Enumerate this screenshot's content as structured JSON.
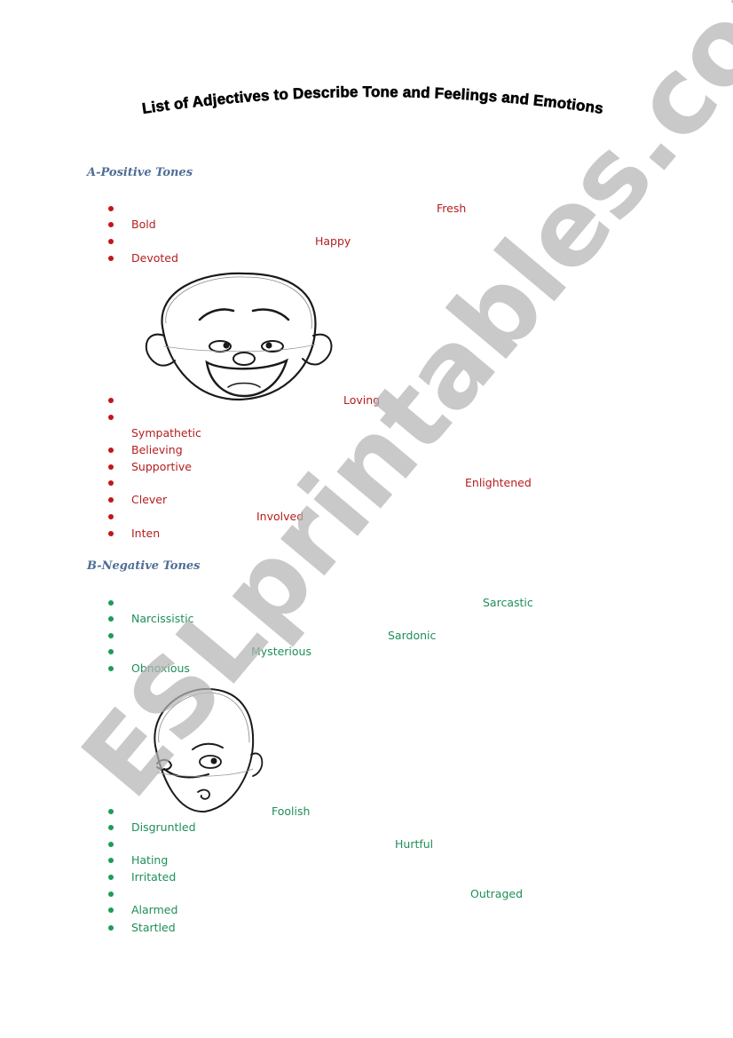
{
  "document": {
    "title": "List of Adjectives to Describe Tone and Feelings and Emotions",
    "watermark": "ESLprintables.com"
  },
  "sections": [
    {
      "heading": "A-Positive Tones",
      "color": "#b51d1d",
      "items": [
        "Fresh",
        "Bold",
        "Happy",
        "Devoted",
        "Loving",
        "",
        "Sympathetic",
        "Believing",
        "Supportive",
        "Enlightened",
        "Clever",
        "Involved",
        "Inten"
      ],
      "image": "happy-face-sketch"
    },
    {
      "heading": "B-Negative Tones",
      "color": "#1e8f57",
      "items": [
        "Sarcastic",
        "Narcissistic",
        "Sardonic",
        "Mysterious",
        "Obnoxious",
        "Foolish",
        "Disgruntled",
        "Hurtful",
        "Hating",
        "Irritated",
        "Outraged",
        "Alarmed",
        "Startled"
      ],
      "image": "worried-face-sketch"
    }
  ],
  "colors": {
    "heading": "#4f6d96",
    "positive": "#b51d1d",
    "negative": "#1e8f57",
    "watermark": "#b5b5b5"
  }
}
